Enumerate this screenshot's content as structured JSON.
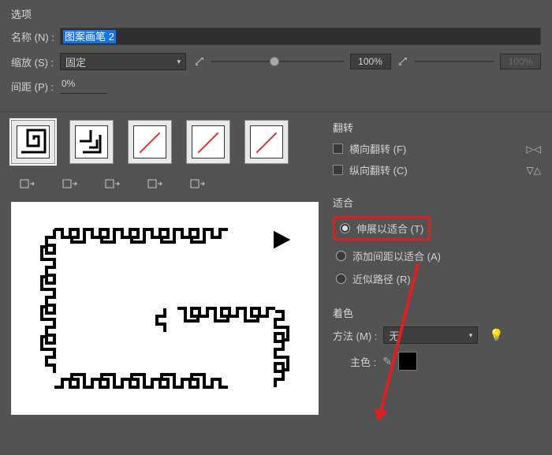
{
  "panel": {
    "title": "选项",
    "name_label": "名称 (N) :",
    "name_value": "图案画笔 2",
    "scale_label": "缩放 (S) :",
    "scale_mode": "固定",
    "scale_pct": "100%",
    "scale_pct2": "100%",
    "spacing_label": "间距 (P) :",
    "spacing_value": "0%"
  },
  "flip": {
    "title": "翻转",
    "horizontal": "横向翻转 (F)",
    "vertical": "纵向翻转 (C)"
  },
  "fit": {
    "title": "适合",
    "stretch": "伸展以适合 (T)",
    "addspace": "添加间距以适合 (A)",
    "approx": "近似路径 (R)"
  },
  "colorize": {
    "title": "着色",
    "method_label": "方法 (M) :",
    "method_value": "无",
    "keycolor_label": "主色 :"
  },
  "tiles": {
    "names": [
      "side-tile",
      "outer-corner-tile",
      "inner-corner-tile",
      "start-tile",
      "end-tile"
    ]
  }
}
